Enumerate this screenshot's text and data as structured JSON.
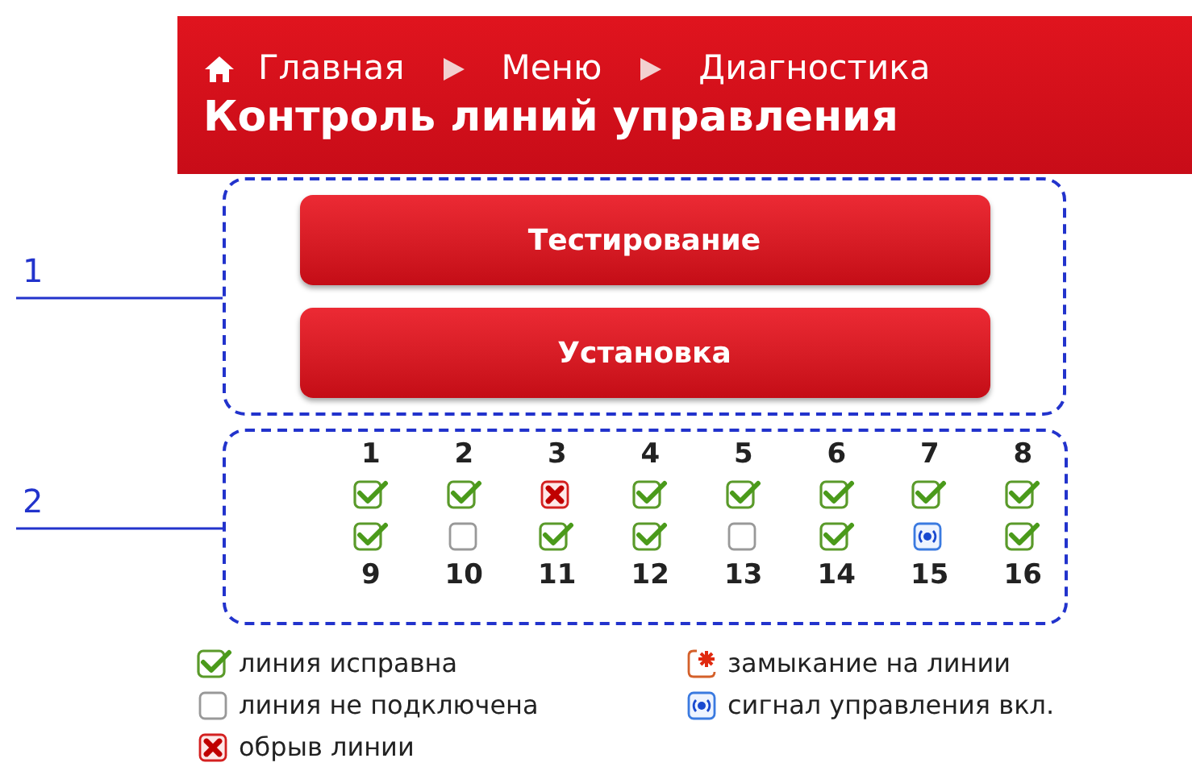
{
  "breadcrumb": [
    {
      "label": "Главная",
      "kind": "home"
    },
    {
      "label": "Меню",
      "kind": "step"
    },
    {
      "label": "Диагностика",
      "kind": "step"
    }
  ],
  "title": "Контроль линий управления",
  "callouts": [
    "1",
    "2"
  ],
  "buttons": [
    "Тестирование",
    "Установка"
  ],
  "lines_top": [
    {
      "number": "1",
      "kind": "ok"
    },
    {
      "number": "2",
      "kind": "ok"
    },
    {
      "number": "3",
      "kind": "break"
    },
    {
      "number": "4",
      "kind": "ok"
    },
    {
      "number": "5",
      "kind": "ok"
    },
    {
      "number": "6",
      "kind": "ok"
    },
    {
      "number": "7",
      "kind": "ok"
    },
    {
      "number": "8",
      "kind": "ok"
    }
  ],
  "lines_bottom": [
    {
      "number": "9",
      "kind": "ok"
    },
    {
      "number": "10",
      "kind": "none"
    },
    {
      "number": "11",
      "kind": "ok"
    },
    {
      "number": "12",
      "kind": "ok"
    },
    {
      "number": "13",
      "kind": "none"
    },
    {
      "number": "14",
      "kind": "ok"
    },
    {
      "number": "15",
      "kind": "signal"
    },
    {
      "number": "16",
      "kind": "ok"
    }
  ],
  "legend": [
    {
      "kind": "ok",
      "label": "линия исправна"
    },
    {
      "kind": "short",
      "label": "замыкание на линии"
    },
    {
      "kind": "none",
      "label": "линия не подключена"
    },
    {
      "kind": "signal",
      "label": "сигнал управления вкл."
    },
    {
      "kind": "break",
      "label": "обрыв линии"
    }
  ]
}
